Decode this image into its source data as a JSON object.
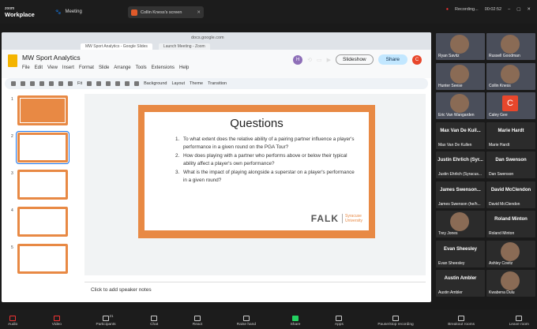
{
  "zoom": {
    "brand_top": "zoom",
    "brand_bottom": "Workplace",
    "meeting_label": "Meeting",
    "share_label": "Collin Kness's screen",
    "recording": "Recording...",
    "time": "00:02:52"
  },
  "browser": {
    "url": "docs.google.com",
    "tabs": [
      "MW Sport Analytics - Google Slides",
      "Launch Meeting - Zoom"
    ]
  },
  "slides": {
    "doc_title": "MW Sport Analytics",
    "menus": [
      "File",
      "Edit",
      "View",
      "Insert",
      "Format",
      "Slide",
      "Arrange",
      "Tools",
      "Extensions",
      "Help"
    ],
    "avatar": "H",
    "slideshow": "Slideshow",
    "share": "Share",
    "user_avatar": "C",
    "toolbar": [
      "Fit",
      "Background",
      "Layout",
      "Theme",
      "Transition"
    ],
    "thumb_numbers": [
      "1",
      "2",
      "3",
      "4",
      "5"
    ],
    "speaker_notes": "Click to add speaker notes"
  },
  "slide": {
    "title": "Questions",
    "questions": [
      "To what extent does the relative ability of a pairing partner influence a player's performance in a given round on the PGA Tour?",
      "How does playing with a partner who performs above or below their typical ability affect a player's own performance?",
      "What is the impact of playing alongside a superstar on a player's performance in a given round?"
    ],
    "logo_main": "FALK",
    "logo_sub1": "Syracuse",
    "logo_sub2": "University"
  },
  "participants": [
    {
      "name": "Ryan Savitz"
    },
    {
      "name": "Russell Goodman"
    },
    {
      "name": "Hunter Seese"
    },
    {
      "name": "Collin Kness"
    },
    {
      "name": "Eric Van Wangarden"
    },
    {
      "name": "Caley Gee",
      "avatar": "C"
    },
    {
      "name": "Max Van De Kullen",
      "big": "Max Van De Kuil..."
    },
    {
      "name": "Marie Hardt",
      "big": "Marie Hardt"
    },
    {
      "name": "Justin Ehrlich (Syracus...",
      "big": "Justin Ehrlich (Syr..."
    },
    {
      "name": "Dan Swenson",
      "big": "Dan Swenson"
    },
    {
      "name": "James Swenson (he/h...",
      "big": "James Swenson..."
    },
    {
      "name": "David McClendon",
      "big": "David McClendon"
    },
    {
      "name": "Trey Jones"
    },
    {
      "name": "Roland Minton",
      "big": "Roland Minton"
    },
    {
      "name": "Evan Sheesley",
      "big": "Evan Sheesley"
    },
    {
      "name": "Ashley Covitz"
    },
    {
      "name": "Austin Ambler",
      "big": "Austin Ambler"
    },
    {
      "name": "Kwabena Dulu"
    }
  ],
  "controls": [
    "Audio",
    "Video",
    "Participants",
    "Chat",
    "React",
    "Raise hand",
    "Share",
    "Apps",
    "Pause/stop recording",
    "Breakout rooms",
    "Leave room"
  ],
  "participant_count": "21"
}
